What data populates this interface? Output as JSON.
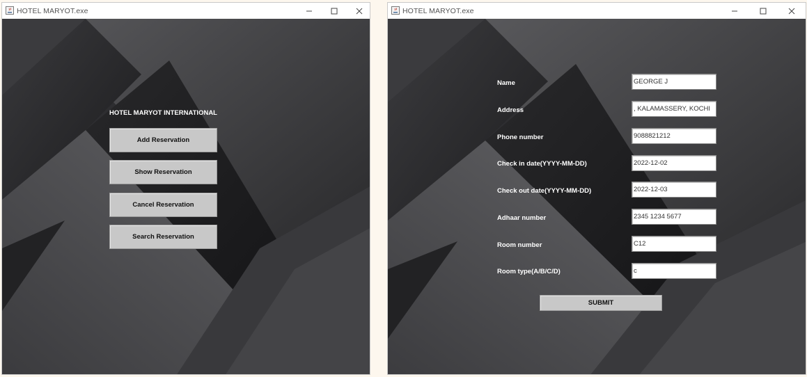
{
  "left_window": {
    "title": "HOTEL MARYOT.exe",
    "heading": "HOTEL MARYOT INTERNATIONAL",
    "buttons": {
      "add": "Add Reservation",
      "show": "Show Reservation",
      "cancel": "Cancel Reservation",
      "search": "Search Reservation"
    }
  },
  "right_window": {
    "title": "HOTEL MARYOT.exe",
    "form": {
      "name": {
        "label": "Name",
        "value": "GEORGE J"
      },
      "address": {
        "label": "Address",
        "value": ", KALAMASSERY, KOCHI"
      },
      "phone": {
        "label": "Phone number",
        "value": "9088821212"
      },
      "checkin": {
        "label": "Check in date(YYYY-MM-DD)",
        "value": "2022-12-02"
      },
      "checkout": {
        "label": "Check out date(YYYY-MM-DD)",
        "value": "2022-12-03"
      },
      "adhaar": {
        "label": "Adhaar number",
        "value": "2345 1234 5677"
      },
      "room_number": {
        "label": "Room number",
        "value": "C12"
      },
      "room_type": {
        "label": "Room type(A/B/C/D)",
        "value": "c"
      }
    },
    "submit_label": "SUBMIT"
  },
  "icons": {
    "app": "java-app-icon",
    "minimize": "minimize-icon",
    "maximize": "maximize-icon",
    "close": "close-icon"
  },
  "colors": {
    "background_dark": "#1c1c1e",
    "background_mid": "#3a3a3d",
    "button_gray": "#c8c8c8",
    "label_white": "#ffffff"
  }
}
